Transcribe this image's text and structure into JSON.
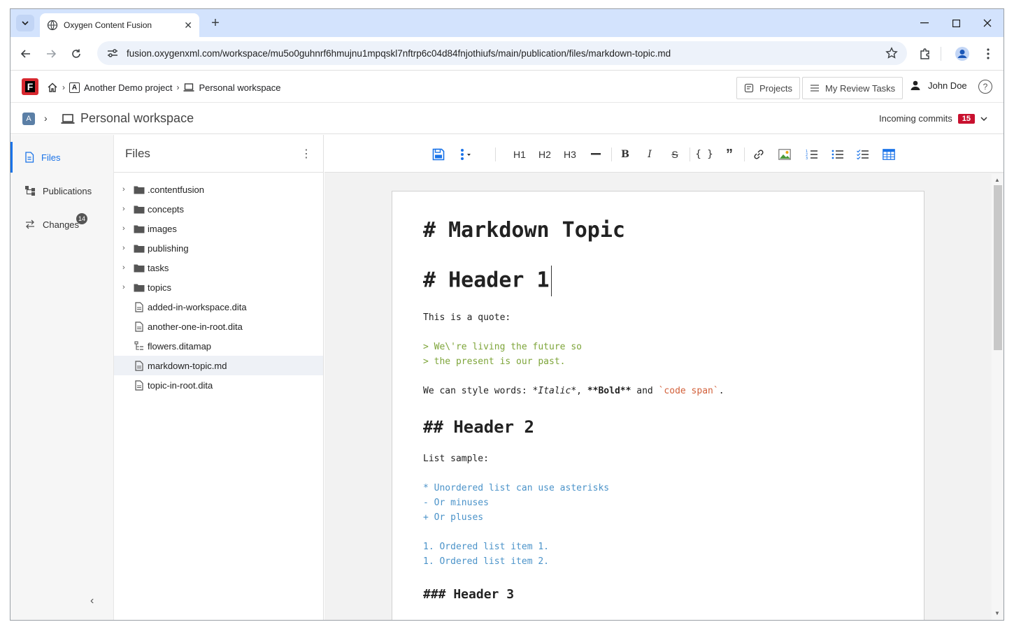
{
  "browser": {
    "tab_title": "Oxygen Content Fusion",
    "url": "fusion.oxygenxml.com/workspace/mu5o0guhnrf6hmujnu1mpqskl7nftrp6c04d84fnjothiufs/main/publication/files/markdown-topic.md"
  },
  "header": {
    "logo_letter": "F",
    "breadcrumb": {
      "project_badge": "A",
      "project": "Another Demo project",
      "workspace": "Personal workspace"
    },
    "projects_label": "Projects",
    "review_label": "My Review Tasks",
    "user_name": "John Doe",
    "help_glyph": "?"
  },
  "workspace_bar": {
    "badge": "A",
    "title": "Personal workspace",
    "incoming_label": "Incoming commits",
    "incoming_count": "15"
  },
  "leftnav": {
    "items": [
      {
        "label": "Files",
        "icon": "file-icon"
      },
      {
        "label": "Publications",
        "icon": "publications-icon"
      },
      {
        "label": "Changes",
        "icon": "swap-icon"
      }
    ],
    "changes_badge": "14"
  },
  "files_panel": {
    "title": "Files",
    "items": [
      {
        "label": ".contentfusion",
        "type": "folder"
      },
      {
        "label": "concepts",
        "type": "folder"
      },
      {
        "label": "images",
        "type": "folder"
      },
      {
        "label": "publishing",
        "type": "folder"
      },
      {
        "label": "tasks",
        "type": "folder"
      },
      {
        "label": "topics",
        "type": "folder"
      },
      {
        "label": "added-in-workspace.dita",
        "type": "file"
      },
      {
        "label": "another-one-in-root.dita",
        "type": "file"
      },
      {
        "label": "flowers.ditamap",
        "type": "map"
      },
      {
        "label": "markdown-topic.md",
        "type": "file",
        "selected": true
      },
      {
        "label": "topic-in-root.dita",
        "type": "file"
      }
    ]
  },
  "toolbar": {
    "h1": "H1",
    "h2": "H2",
    "h3": "H3",
    "bold": "B",
    "italic": "I",
    "strike": "S",
    "code": "{ }",
    "quote": "”"
  },
  "document": {
    "title": "# Markdown Topic",
    "h1": "# Header 1",
    "quote_intro": "This is a quote:",
    "quote_lines": [
      "> We\\'re living the future so",
      "> the present is our past."
    ],
    "style_prefix": "We can style words: ",
    "style_italic": "*Italic*",
    "style_sep1": ", ",
    "style_bold": "**Bold**",
    "style_sep2": " and ",
    "style_code": "`code span`",
    "style_end": ".",
    "h2": "## Header 2",
    "list_intro": "List sample:",
    "unordered": [
      "* Unordered list can use asterisks",
      "- Or minuses",
      "+ Or pluses"
    ],
    "ordered": [
      "1. Ordered list item 1.",
      "1. Ordered list item 2."
    ],
    "h3": "### Header 3"
  }
}
